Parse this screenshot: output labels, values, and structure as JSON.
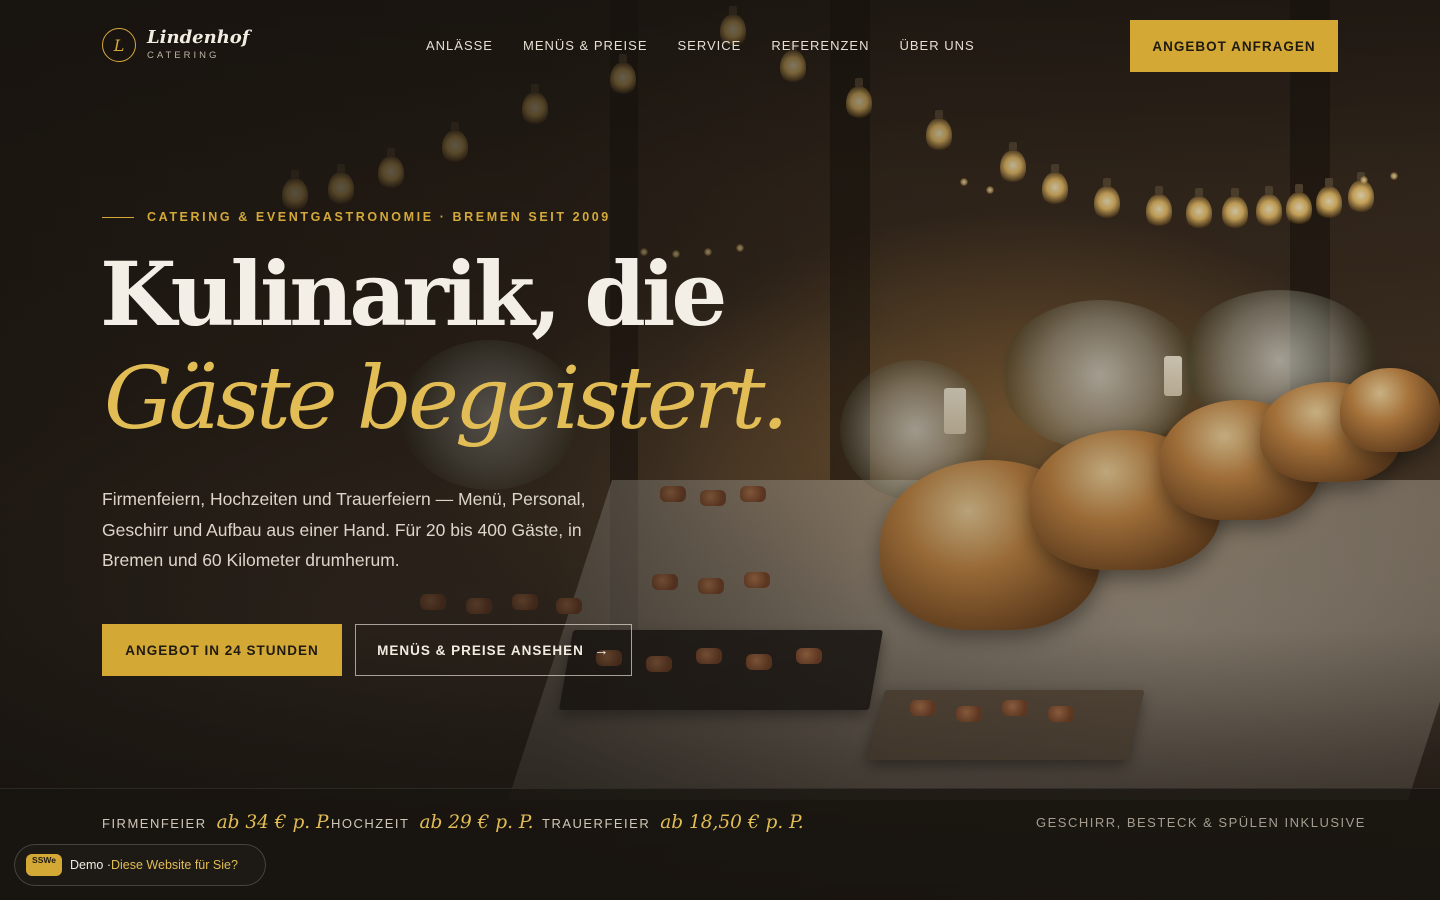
{
  "brand": {
    "mark": "L",
    "name": "Lindenhof",
    "sub": "CATERING",
    "accent_color": "#d3a835"
  },
  "nav": {
    "items": [
      {
        "label": "ANLÄSSE"
      },
      {
        "label": "MENÜS & PREISE"
      },
      {
        "label": "SERVICE"
      },
      {
        "label": "REFERENZEN"
      },
      {
        "label": "ÜBER UNS"
      }
    ],
    "cta": "ANGEBOT ANFRAGEN"
  },
  "hero": {
    "eyebrow": "CATERING & EVENTGASTRONOMIE · BREMEN SEIT 2009",
    "headline": "Kulinarik, die",
    "headline_accent": "Gäste begeistert.",
    "lead": "Firmenfeiern, Hochzeiten und Trauerfeiern — Menü, Personal, Geschirr und Aufbau aus einer Hand. Für 20 bis 400 Gäste, in Bremen und 60 Kilometer drumherum.",
    "primary_cta": "ANGEBOT IN 24 STUNDEN",
    "secondary_cta": "MENÜS & PREISE ANSEHEN",
    "secondary_icon": "arrow-right-icon"
  },
  "prices": [
    {
      "label": "FIRMENFEIER",
      "value": "ab 34 € p. P."
    },
    {
      "label": "HOCHZEIT",
      "value": "ab 29 € p. P."
    },
    {
      "label": "TRAUERFEIER",
      "value": "ab 18,50 € p. P."
    }
  ],
  "strip_note": "GESCHIRR, BESTECK & SPÜLEN INKLUSIVE",
  "demo_badge": {
    "logo": "SSWe",
    "text": "Demo · ",
    "link": "Diese Website für Sie?"
  }
}
